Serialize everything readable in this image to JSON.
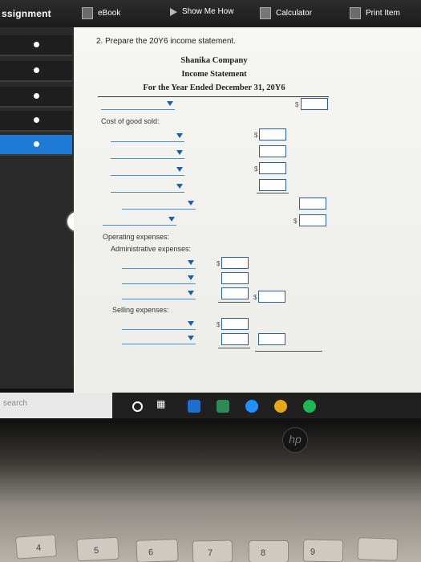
{
  "toolbar": {
    "title": "ssignment",
    "ebook": "eBook",
    "show_me_how": "Show Me How",
    "calculator": "Calculator",
    "print_item": "Print Item"
  },
  "question": {
    "prompt": "2. Prepare the 20Y6 income statement.",
    "company": "Shanika Company",
    "statement": "Income Statement",
    "period": "For the Year Ended December 31, 20Y6"
  },
  "labels": {
    "cost_of_goods_sold": "Cost of good sold:",
    "operating_expenses": "Operating expenses:",
    "administrative_expenses": "Administrative expenses:",
    "selling_expenses": "Selling expenses:"
  },
  "currency_symbol": "$",
  "taskbar": {
    "search_placeholder": "search"
  },
  "laptop": {
    "brand": "hp"
  },
  "keys": [
    "4",
    "5",
    "6",
    "7",
    "8",
    "9"
  ]
}
